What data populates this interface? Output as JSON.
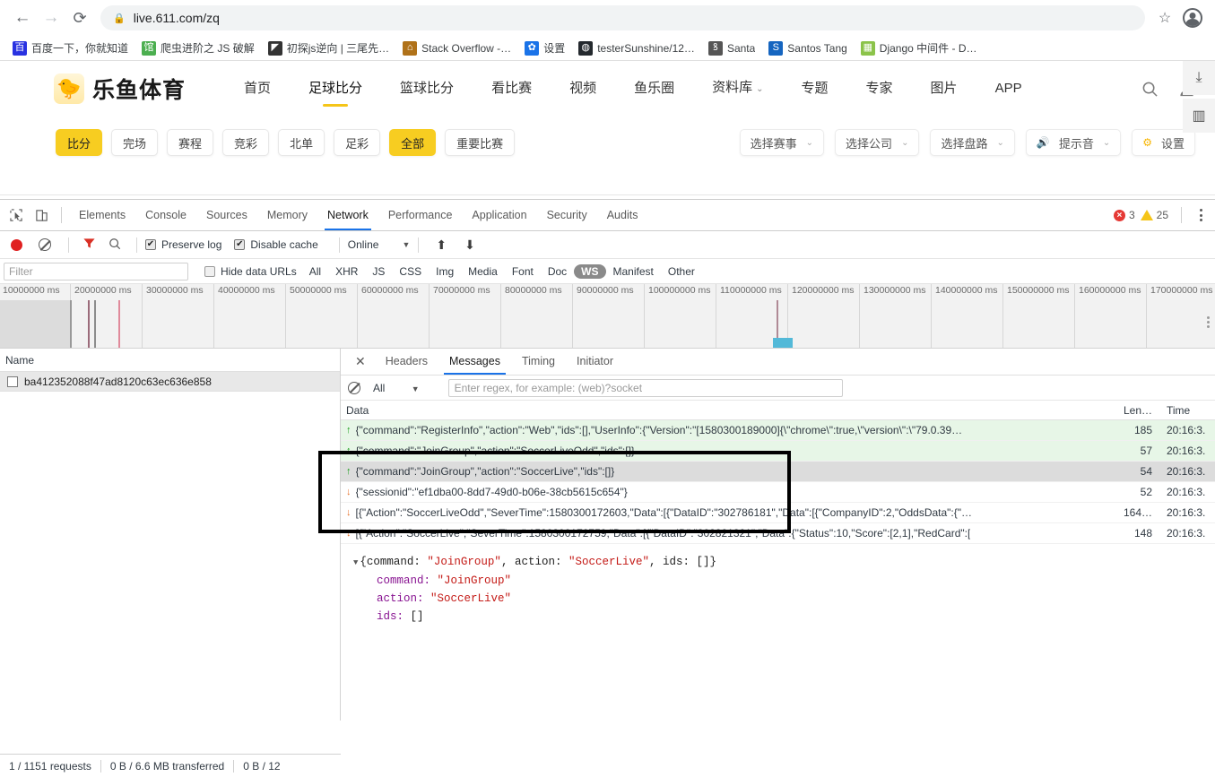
{
  "browser": {
    "back_label": "←",
    "forward_label": "→",
    "reload_label": "⟳",
    "url": "live.611.com/zq",
    "lock_icon": "lock-icon",
    "star_label": "☆",
    "bookmarks": [
      {
        "label": "百度一下，你就知道",
        "glyph": "百",
        "color": "#2932e1"
      },
      {
        "label": "爬虫进阶之 JS 破解",
        "glyph": "馆",
        "color": "#4caf50"
      },
      {
        "label": "初探js逆向 | 三尾先…",
        "glyph": "◤",
        "color": "#333333"
      },
      {
        "label": "Stack Overflow -…",
        "glyph": "⌂",
        "color": "#b07219"
      },
      {
        "label": "设置",
        "glyph": "✿",
        "color": "#1a73e8"
      },
      {
        "label": "testerSunshine/12…",
        "glyph": "◍",
        "color": "#24292e"
      },
      {
        "label": "Santa",
        "glyph": "ꝸ",
        "color": "#555555"
      },
      {
        "label": "Santos Tang",
        "glyph": "S",
        "color": "#1565c0"
      },
      {
        "label": "Django 中间件 - D…",
        "glyph": "▦",
        "color": "#8bc34a"
      }
    ]
  },
  "site": {
    "brand_text": "乐鱼体育",
    "brand_glyph": "🐤",
    "nav": [
      {
        "label": "首页",
        "active": false
      },
      {
        "label": "足球比分",
        "active": true
      },
      {
        "label": "篮球比分",
        "active": false
      },
      {
        "label": "看比赛",
        "active": false
      },
      {
        "label": "视频",
        "active": false
      },
      {
        "label": "鱼乐圈",
        "active": false
      },
      {
        "label": "资料库",
        "active": false,
        "caret": "⌄"
      },
      {
        "label": "专题",
        "active": false
      },
      {
        "label": "专家",
        "active": false
      },
      {
        "label": "图片",
        "active": false
      },
      {
        "label": "APP",
        "active": false
      }
    ],
    "header_icons": [
      "search-icon",
      "user-icon"
    ],
    "filters": [
      {
        "label": "比分",
        "selected": true
      },
      {
        "label": "完场",
        "selected": false
      },
      {
        "label": "赛程",
        "selected": false
      },
      {
        "label": "竞彩",
        "selected": false
      },
      {
        "label": "北单",
        "selected": false
      },
      {
        "label": "足彩",
        "selected": false
      },
      {
        "label": "全部",
        "selected": true
      },
      {
        "label": "重要比赛",
        "selected": false
      }
    ],
    "dropdowns": [
      {
        "label": "选择赛事",
        "caret": "⌄",
        "icon": ""
      },
      {
        "label": "选择公司",
        "caret": "⌄",
        "icon": ""
      },
      {
        "label": "选择盘路",
        "caret": "⌄",
        "icon": ""
      },
      {
        "label": "提示音",
        "caret": "⌄",
        "icon": "speaker-icon"
      },
      {
        "label": "设置",
        "caret": "",
        "icon": "gear-icon"
      }
    ],
    "rail": [
      {
        "label": "⤓",
        "name": "download-rail-button"
      },
      {
        "label": "▥",
        "name": "grid-rail-button"
      }
    ],
    "accent_color": "#f7cd21"
  },
  "devtools": {
    "tabs": [
      {
        "label": "Elements",
        "active": false
      },
      {
        "label": "Console",
        "active": false
      },
      {
        "label": "Sources",
        "active": false
      },
      {
        "label": "Memory",
        "active": false
      },
      {
        "label": "Network",
        "active": true
      },
      {
        "label": "Performance",
        "active": false
      },
      {
        "label": "Application",
        "active": false
      },
      {
        "label": "Security",
        "active": false
      },
      {
        "label": "Audits",
        "active": false
      }
    ],
    "error_count": "3",
    "warning_count": "25",
    "toolbar": {
      "record_label": "record-button",
      "clear_label": "clear-button",
      "filter_label": "filter-button",
      "search_label": "search-button",
      "preserve_log_label": "Preserve log",
      "preserve_log_checked": "✔",
      "disable_cache_label": "Disable cache",
      "disable_cache_checked": "✔",
      "throttling_value": "Online",
      "throttling_caret": "▼",
      "import_label": "⬆",
      "export_label": "⬇"
    },
    "filters": {
      "filter_placeholder": "Filter",
      "filter_value": "",
      "hide_data_urls_label": "Hide data URLs",
      "types": [
        {
          "label": "All",
          "selected": false
        },
        {
          "label": "XHR",
          "selected": false
        },
        {
          "label": "JS",
          "selected": false
        },
        {
          "label": "CSS",
          "selected": false
        },
        {
          "label": "Img",
          "selected": false
        },
        {
          "label": "Media",
          "selected": false
        },
        {
          "label": "Font",
          "selected": false
        },
        {
          "label": "Doc",
          "selected": false
        },
        {
          "label": "WS",
          "selected": true
        },
        {
          "label": "Manifest",
          "selected": false
        },
        {
          "label": "Other",
          "selected": false
        }
      ]
    },
    "overview_ticks": [
      "10000000 ms",
      "20000000 ms",
      "30000000 ms",
      "40000000 ms",
      "50000000 ms",
      "60000000 ms",
      "70000000 ms",
      "80000000 ms",
      "90000000 ms",
      "100000000 ms",
      "110000000 ms",
      "120000000 ms",
      "130000000 ms",
      "140000000 ms",
      "150000000 ms",
      "160000000 ms",
      "170000000 ms"
    ],
    "requests_column": "Name",
    "requests": [
      {
        "name": "ba412352088f47ad8120c63ec636e858",
        "selected": true
      }
    ],
    "detail_tabs": [
      {
        "label": "Headers",
        "active": false
      },
      {
        "label": "Messages",
        "active": true
      },
      {
        "label": "Timing",
        "active": false
      },
      {
        "label": "Initiator",
        "active": false
      }
    ],
    "detail_close": "✕",
    "messages_toolbar": {
      "clear_label": "clear-messages-button",
      "type_filter_value": "All",
      "type_filter_caret": "▼",
      "regex_placeholder": "Enter regex, for example: (web)?socket",
      "regex_value": ""
    },
    "messages_columns": [
      "Data",
      "Len…",
      "Time"
    ],
    "messages": [
      {
        "direction": "send",
        "arrow": "↑",
        "data": "{\"command\":\"RegisterInfo\",\"action\":\"Web\",\"ids\":[],\"UserInfo\":{\"Version\":\"[1580300189000]{\\\"chrome\\\":true,\\\"version\\\":\\\"79.0.39…",
        "length": "185",
        "time": "20:16:3."
      },
      {
        "direction": "send",
        "arrow": "↑",
        "data": "{\"command\":\"JoinGroup\",\"action\":\"SoccerLiveOdd\",\"ids\":[]}",
        "length": "57",
        "time": "20:16:3."
      },
      {
        "direction": "send",
        "arrow": "↑",
        "data": "{\"command\":\"JoinGroup\",\"action\":\"SoccerLive\",\"ids\":[]}",
        "length": "54",
        "time": "20:16:3.",
        "selected": true
      },
      {
        "direction": "receive",
        "arrow": "↓",
        "data": "{\"sessionid\":\"ef1dba00-8dd7-49d0-b06e-38cb5615c654\"}",
        "length": "52",
        "time": "20:16:3."
      },
      {
        "direction": "receive",
        "arrow": "↓",
        "data": "[{\"Action\":\"SoccerLiveOdd\",\"SeverTime\":1580300172603,\"Data\":[{\"DataID\":\"302786181\",\"Data\":[{\"CompanyID\":2,\"OddsData\":{\"…",
        "length": "164…",
        "time": "20:16:3."
      },
      {
        "direction": "receive",
        "arrow": "↓",
        "data": "[{\"Action\":\"SoccerLive\",\"SeverTime\":1580300172759,\"Data\":[{\"DataID\":\"302821321\",\"Data\":{\"Status\":10,\"Score\":[2,1],\"RedCard\":[",
        "length": "148",
        "time": "20:16:3."
      }
    ],
    "json_detail": {
      "arrow": "▼",
      "summary_prefix": "{command: ",
      "summary_command": "\"JoinGroup\"",
      "summary_mid": ", action: ",
      "summary_action": "\"SoccerLive\"",
      "summary_suffix": ", ids: []}",
      "rows": [
        {
          "key": "command:",
          "value": "\"JoinGroup\""
        },
        {
          "key": "action:",
          "value": "\"SoccerLive\""
        },
        {
          "key": "ids:",
          "value": "[]"
        }
      ]
    },
    "statusbar": {
      "requests": "1 / 1151 requests",
      "transferred": "0 B / 6.6 MB transferred",
      "resources": "0 B / 12"
    }
  }
}
